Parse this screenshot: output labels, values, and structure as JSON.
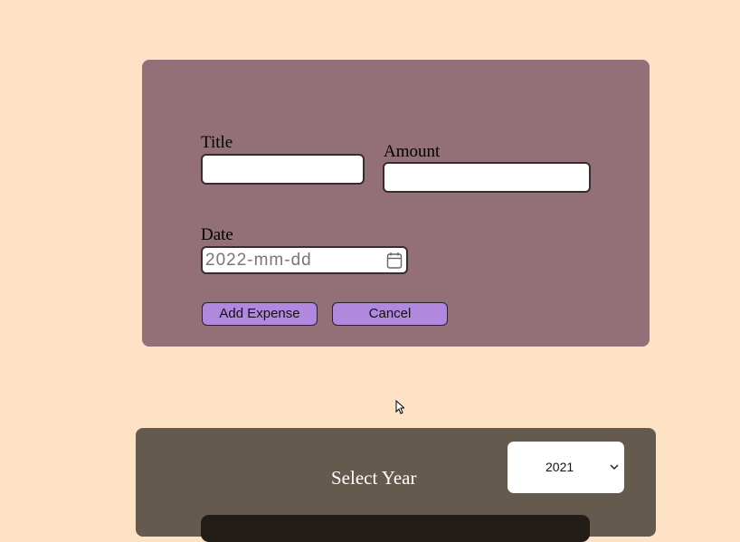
{
  "form": {
    "title_label": "Title",
    "title_value": "",
    "amount_label": "Amount",
    "amount_value": "",
    "date_label": "Date",
    "date_placeholder": "2022-mm-dd",
    "add_button": "Add Expense",
    "cancel_button": "Cancel"
  },
  "filter": {
    "label": "Select Year",
    "selected_year": "2021"
  },
  "icons": {
    "date": "calendar-icon",
    "select": "chevron-down-icon",
    "pointer": "mouse-cursor-icon"
  },
  "colors": {
    "page_bg": "#fee2c6",
    "form_bg": "#937078",
    "button_bg": "#b088dd",
    "filter_bg": "#655a4e"
  }
}
